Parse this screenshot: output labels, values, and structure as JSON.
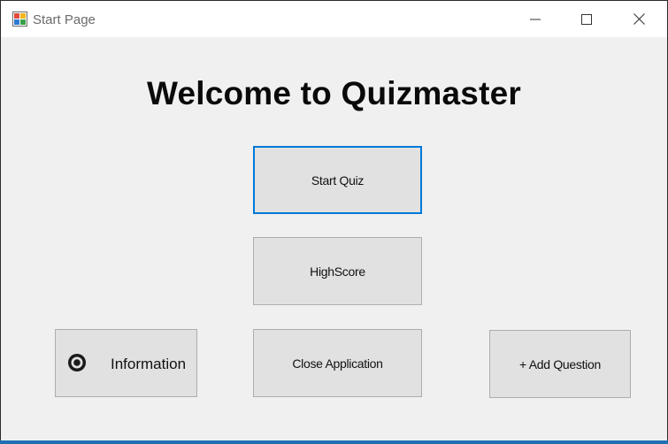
{
  "window": {
    "title": "Start Page",
    "icon": "windows-form-icon",
    "controls": {
      "minimize": "minimize-icon",
      "maximize": "maximize-icon",
      "close": "close-icon"
    }
  },
  "main": {
    "heading": "Welcome to Quizmaster",
    "buttons": {
      "start_quiz": "Start Quiz",
      "highscore": "HighScore",
      "close_application": "Close Application",
      "add_question": "+ Add Question",
      "information": "Information"
    },
    "information_icon": "radio-info-icon",
    "focused_button": "Start Quiz"
  },
  "colors": {
    "focus_border": "#0078d7",
    "button_bg": "#e1e1e1",
    "window_bg": "#f0f0f0",
    "taskbar_accent": "#1e6fb3"
  }
}
